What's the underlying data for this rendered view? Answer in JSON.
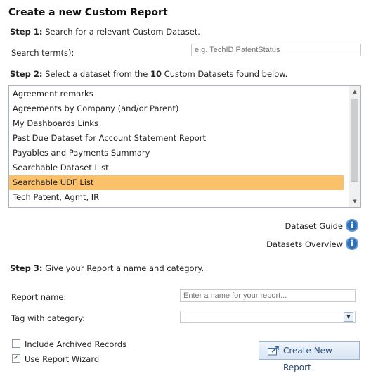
{
  "title": "Create a new Custom Report",
  "step1": {
    "label": "Step 1:",
    "text": " Search for a relevant Custom Dataset."
  },
  "search": {
    "label": "Search term(s):",
    "placeholder": "e.g. TechID PatentStatus",
    "value": ""
  },
  "step2": {
    "label": "Step 2:",
    "text_before": " Select a dataset from the ",
    "count": "10",
    "text_after": " Custom Datasets found below."
  },
  "datasets": [
    "Agreement remarks",
    "Agreements by Company (and/or Parent)",
    "My Dashboards Links",
    "Past Due Dataset for Account Statement Report",
    "Payables and Payments Summary",
    "Searchable Dataset List",
    "Searchable UDF List",
    "Tech Patent, Agmt, IR"
  ],
  "selected_dataset": "Searchable UDF List",
  "links": {
    "guide": "Dataset Guide",
    "overview": "Datasets Overview"
  },
  "icons": {
    "info": "info-icon",
    "scroll_up": "chevron-up-icon",
    "scroll_down": "chevron-down-icon",
    "create": "create-report-icon"
  },
  "step3": {
    "label": "Step 3:",
    "text": " Give your Report a name and category."
  },
  "report_name": {
    "label": "Report name:",
    "placeholder": "Enter a name for your report...",
    "value": ""
  },
  "category": {
    "label": "Tag with category:",
    "value": ""
  },
  "checkboxes": {
    "archived": {
      "label": "Include Archived Records",
      "checked": false
    },
    "wizard": {
      "label": "Use Report Wizard",
      "checked": true
    }
  },
  "create_button": "Create New Report",
  "colors": {
    "selected": "#fbc06a",
    "info_icon": "#2f6fb5",
    "button_text": "#2a4a72"
  }
}
